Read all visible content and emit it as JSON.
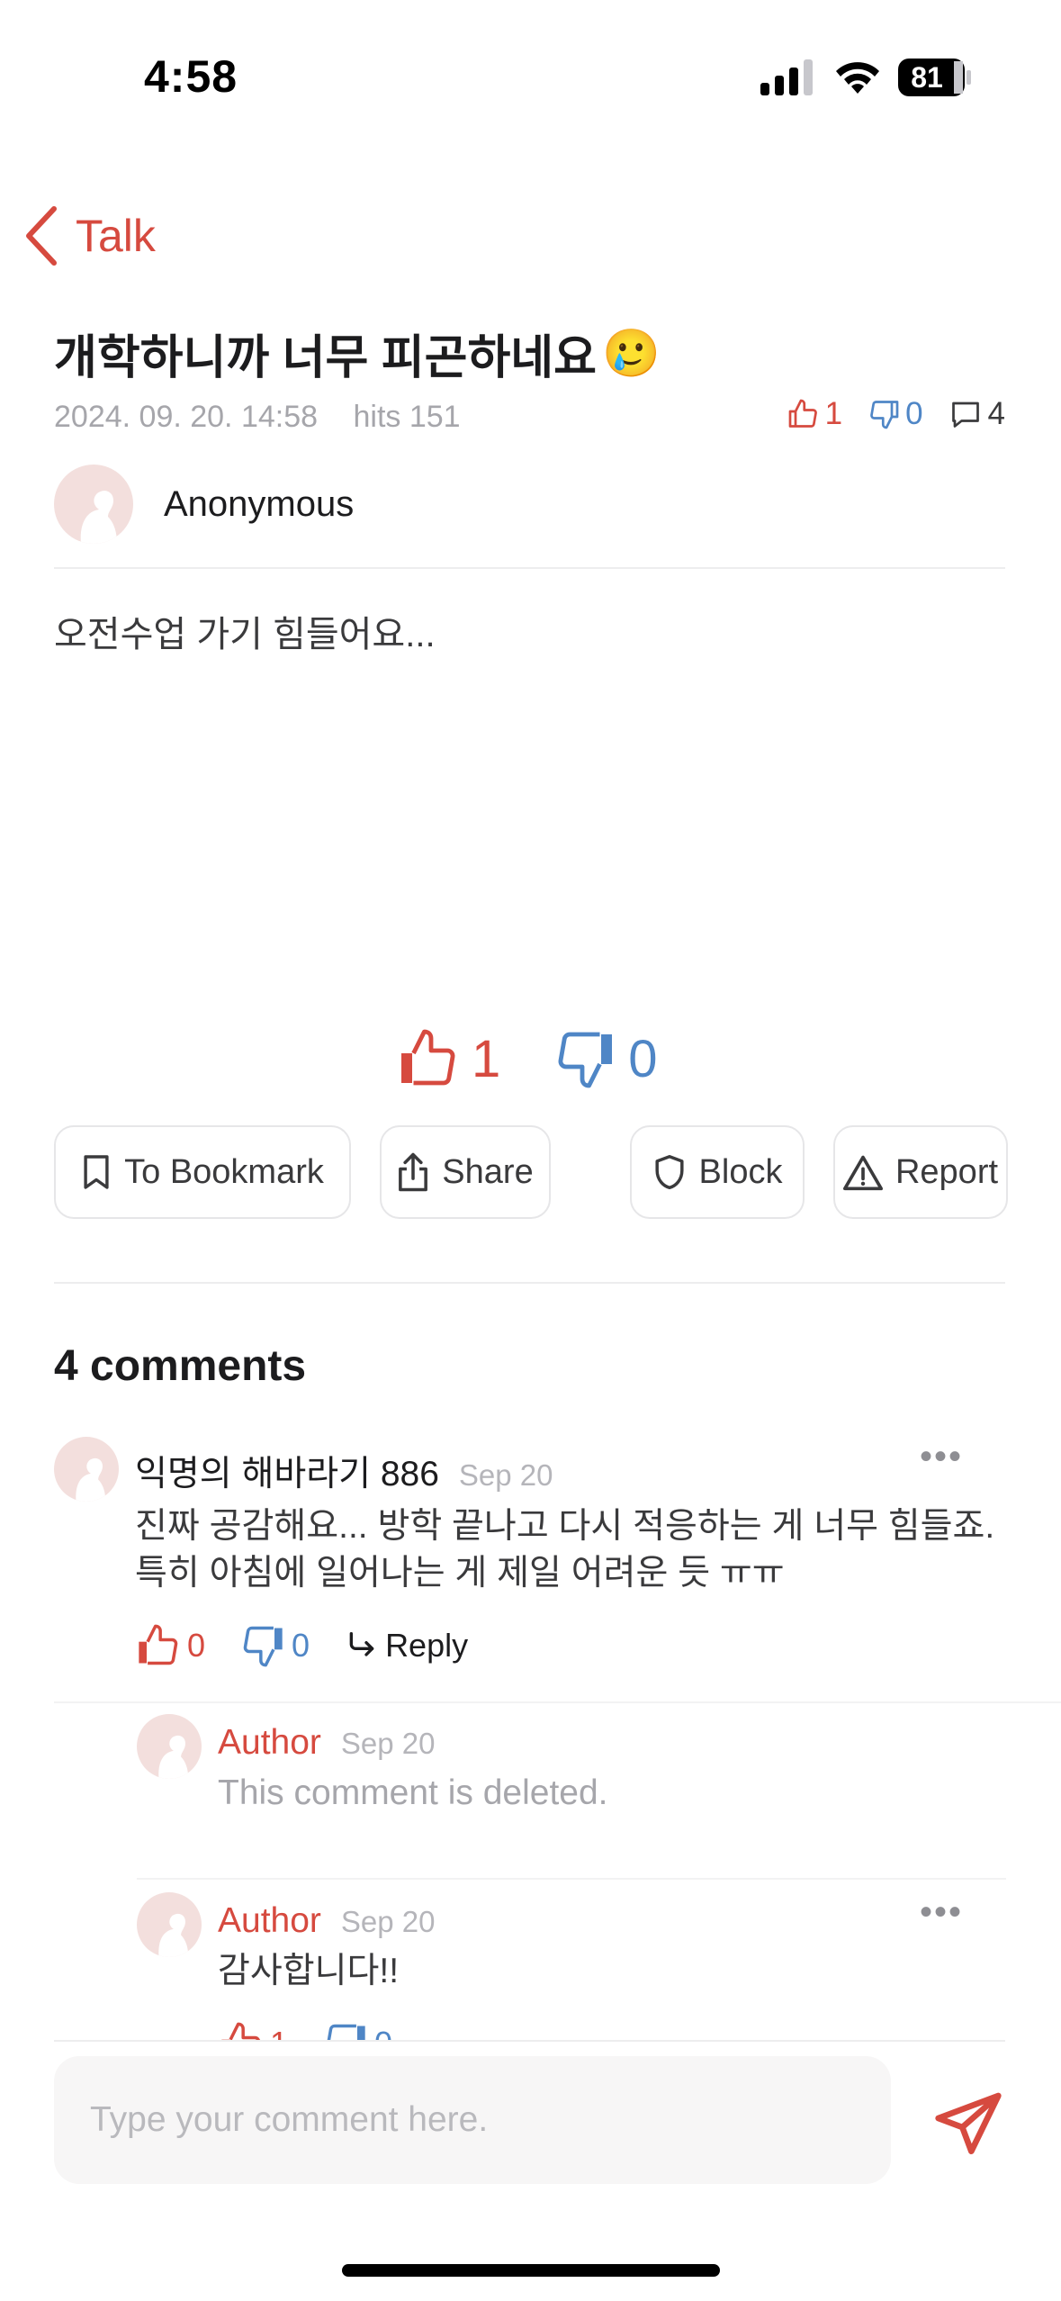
{
  "status_bar": {
    "time": "4:58",
    "battery": "81"
  },
  "nav": {
    "back_label": "Talk"
  },
  "post": {
    "title": "개학하니까 너무 피곤하네요",
    "title_emoji": "🥲",
    "date": "2024. 09. 20. 14:58",
    "hits": "hits 151",
    "likes": "1",
    "dislikes": "0",
    "comments": "4",
    "author": "Anonymous",
    "body": "오전수업 가기 힘들어요..."
  },
  "votes": {
    "likes": "1",
    "dislikes": "0"
  },
  "actions": {
    "bookmark": "To Bookmark",
    "share": "Share",
    "block": "Block",
    "report": "Report"
  },
  "comments_section": {
    "title": "4 comments",
    "items": [
      {
        "name": "익명의 해바라기 886",
        "date": "Sep 20",
        "text": "진짜 공감해요... 방학 끝나고 다시 적응하는 게 너무 힘들죠. 특히 아침에 일어나는 게 제일 어려운 듯 ㅠㅠ",
        "likes": "0",
        "dislikes": "0",
        "reply_label": "Reply"
      },
      {
        "name": "Author",
        "date": "Sep 20",
        "text": "This comment is deleted."
      },
      {
        "name": "Author",
        "date": "Sep 20",
        "text": "감사합니다!!",
        "likes": "1",
        "dislikes": "0"
      }
    ]
  },
  "composer": {
    "placeholder": "Type your comment here."
  },
  "colors": {
    "accent_red": "#d64a3f",
    "accent_blue": "#4f86c6"
  }
}
